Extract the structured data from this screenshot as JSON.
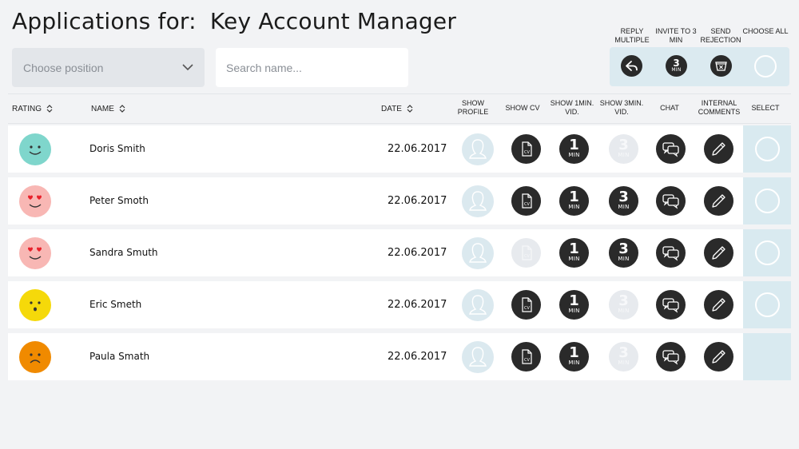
{
  "header": {
    "title_prefix": "Applications for:",
    "position_title": "Key Account Manager"
  },
  "filters": {
    "position_select_label": "Choose position",
    "search_placeholder": "Search name..."
  },
  "bulk_actions": {
    "reply_multiple": "REPLY MULTIPLE",
    "invite_3min": "INVITE TO 3 MIN",
    "send_rejection": "SEND REJECTION",
    "choose_all": "CHOOSE ALL",
    "invite_icon_number": "3",
    "invite_icon_unit": "MIN"
  },
  "columns": {
    "rating": "RATING",
    "name": "NAME",
    "date": "DATE",
    "show_profile": "SHOW PROFILE",
    "show_cv": "SHOW CV",
    "show_1min": "SHOW 1MIN. VID.",
    "show_3min": "SHOW 3MIN. VID.",
    "chat": "CHAT",
    "internal_comments": "INTERNAL COMMENTS",
    "select": "SELECT"
  },
  "icon_text": {
    "cv": "CV",
    "one": "1",
    "three": "3",
    "min": "MIN"
  },
  "colors": {
    "teal_face": "#7fd6cc",
    "love_face": "#f8b7b4",
    "yellow_face": "#f5d90a",
    "orange_face": "#f08a00",
    "dark_icon": "#2a2a2a",
    "select_bg": "#d9eaf0"
  },
  "rows": [
    {
      "rating": "happy-face-icon",
      "name": "Doris Smith",
      "date": "22.06.2017",
      "cv": true,
      "vid1": true,
      "vid3": false,
      "select": true
    },
    {
      "rating": "heart-eyes-face-icon",
      "name": "Peter Smoth",
      "date": "22.06.2017",
      "cv": true,
      "vid1": true,
      "vid3": true,
      "select": true
    },
    {
      "rating": "heart-eyes-face-icon",
      "name": "Sandra Smuth",
      "date": "22.06.2017",
      "cv": false,
      "vid1": true,
      "vid3": true,
      "select": true
    },
    {
      "rating": "surprised-face-icon",
      "name": "Eric Smeth",
      "date": "22.06.2017",
      "cv": true,
      "vid1": true,
      "vid3": false,
      "select": true
    },
    {
      "rating": "sad-face-icon",
      "name": "Paula Smath",
      "date": "22.06.2017",
      "cv": true,
      "vid1": true,
      "vid3": false,
      "select": false
    }
  ]
}
